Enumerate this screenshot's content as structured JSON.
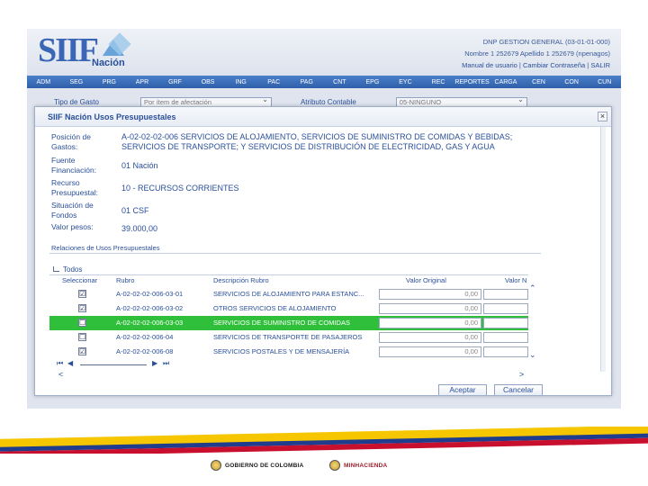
{
  "header": {
    "logo_text": "SIIF",
    "logo_subtitle": "Nación",
    "entity_line": "DNP GESTION GENERAL (03-01-01-000)",
    "user_line": "Nombre 1 252679 Apellido 1 252679 (npenagos)",
    "links": [
      "Manual de usuario",
      "Cambiar Contraseña",
      "SALIR"
    ],
    "link_separator": "|"
  },
  "menu": [
    "ADM",
    "SEG",
    "PRG",
    "APR",
    "GRF",
    "OBS",
    "ING",
    "PAC",
    "PAG",
    "CNT",
    "EPG",
    "EYC",
    "REC",
    "REPORTES",
    "CARGA",
    "CEN",
    "CON",
    "CUN"
  ],
  "background_filter": {
    "tipo_gasto_label": "Tipo de Gasto",
    "tipo_gasto_value": "Por ítem de afectación",
    "atributo_label": "Atributo Contable",
    "atributo_value": "05-NINGUNO"
  },
  "dialog": {
    "title": "SIIF Nación   Usos Presupuestales",
    "close_glyph": "×",
    "details": [
      {
        "label": "Posición de Gastos:",
        "value": "A-02-02-02-006 SERVICIOS DE ALOJAMIENTO, SERVICIOS DE SUMINISTRO DE COMIDAS Y BEBIDAS; SERVICIOS DE TRANSPORTE; Y SERVICIOS DE DISTRIBUCIÓN DE ELECTRICIDAD, GAS Y AGUA"
      },
      {
        "label": "Fuente Financiación:",
        "value": "01 Nación"
      },
      {
        "label": "Recurso Presupuestal:",
        "value": "10 - RECURSOS CORRIENTES"
      },
      {
        "label": "Situación de Fondos",
        "value": "01 CSF"
      },
      {
        "label": "Valor pesos:",
        "value": "39.000,00"
      }
    ],
    "section_title": "Relaciones de Usos Presupuestales",
    "tree_root": "Todos",
    "grid": {
      "columns": [
        "Seleccionar",
        "Rubro",
        "Descripción Rubro",
        "Valor Original",
        "Valor N"
      ],
      "rows": [
        {
          "checked": "☑",
          "rubro": "A-02-02-02-006-03-01",
          "descripcion": "SERVICIOS DE ALOJAMIENTO PARA ESTANC...",
          "valor_original": "0,00",
          "selected": false
        },
        {
          "checked": "☑",
          "rubro": "A-02-02-02-006-03-02",
          "descripcion": "OTROS SERVICIOS DE ALOJAMIENTO",
          "valor_original": "0,00",
          "selected": false
        },
        {
          "checked": "☐",
          "rubro": "A-02-02-02-006-03-03",
          "descripcion": "SERVICIOS DE SUMINISTRO DE COMIDAS",
          "valor_original": "0,00",
          "selected": true
        },
        {
          "checked": "☐",
          "rubro": "A-02-02-02-006-04",
          "descripcion": "SERVICIOS DE TRANSPORTE DE PASAJEROS",
          "valor_original": "0,00",
          "selected": false
        },
        {
          "checked": "☑",
          "rubro": "A-02-02-02-006-08",
          "descripcion": "SERVICIOS POSTALES Y DE MENSAJERÍA",
          "valor_original": "0,00",
          "selected": false
        }
      ]
    },
    "pager": {
      "first": "⏮",
      "prev": "◀",
      "next": "▶",
      "last": "⏭"
    },
    "buttons": {
      "accept": "Aceptar",
      "cancel": "Cancelar"
    }
  },
  "footer": {
    "logo_left": "GOBIERNO DE COLOMBIA",
    "logo_right": "MINHACIENDA",
    "band_colors": [
      "#f6c700",
      "#1f3d8c",
      "#c8102e"
    ]
  }
}
